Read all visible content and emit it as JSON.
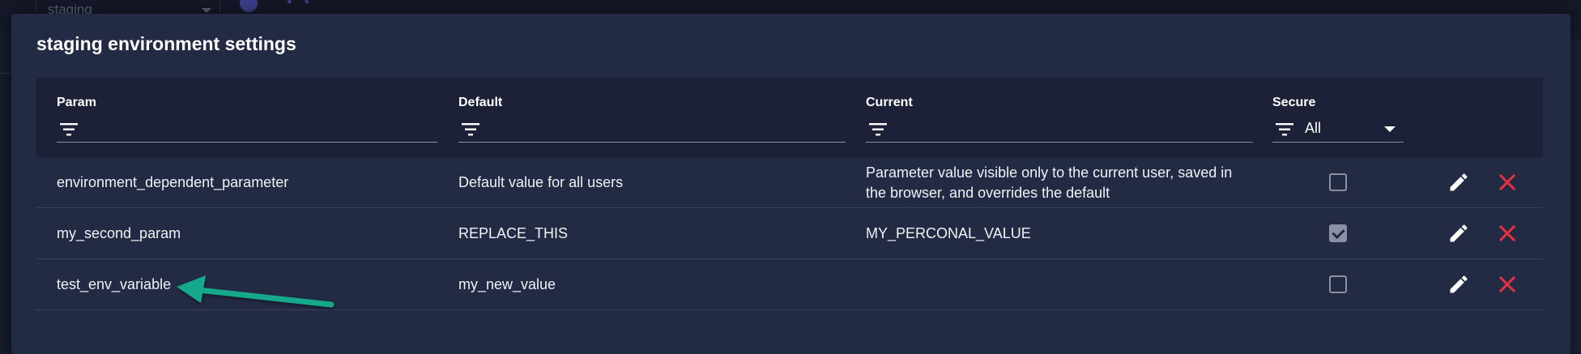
{
  "background": {
    "env_select_value": "staging"
  },
  "dialog": {
    "title": "staging environment settings"
  },
  "table": {
    "columns": [
      {
        "label": "Param",
        "filter_value": ""
      },
      {
        "label": "Default",
        "filter_value": ""
      },
      {
        "label": "Current",
        "filter_value": ""
      },
      {
        "label": "Secure",
        "filter_value": "All"
      }
    ],
    "rows": [
      {
        "param": "environment_dependent_parameter",
        "default": "Default value for all users",
        "current": "Parameter value visible only to the current user, saved in the browser, and overrides the default",
        "secure": false
      },
      {
        "param": "my_second_param",
        "default": "REPLACE_THIS",
        "current": "MY_PERCONAL_VALUE",
        "secure": true
      },
      {
        "param": "test_env_variable",
        "default": "my_new_value",
        "current": "",
        "secure": false
      }
    ]
  },
  "colors": {
    "dialog_bg": "#232a44",
    "header_bg": "#1c2137",
    "delete_red": "#e2323f",
    "annotation_arrow": "#16a88a"
  },
  "icons": {
    "filter": "filter-icon",
    "edit": "pencil-icon",
    "delete": "close-icon",
    "settings": "gear-icon",
    "refresh": "refresh-icon"
  }
}
